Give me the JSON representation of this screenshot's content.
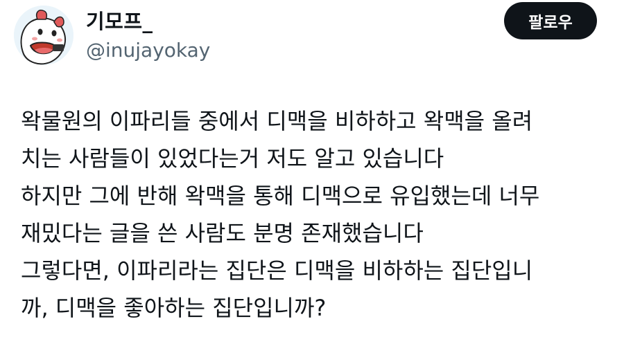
{
  "user": {
    "display_name": "기모프_",
    "handle": "@inujayokay",
    "avatar_icon": "cartoon-dog-avatar"
  },
  "follow_button": {
    "label": "팔로우"
  },
  "tweet": {
    "lines": [
      "왁물원의 이파리들 중에서 디맥을 비하하고 왁맥을 올려",
      "치는 사람들이 있었다는거 저도 알고 있습니다",
      "하지만 그에 반해 왁맥을 통해 디맥으로 유입했는데 너무",
      "재밌다는 글을 쓴 사람도 분명 존재했습니다",
      "그렇다면, 이파리라는 집단은 디맥을 비하하는 집단입니",
      "까, 디맥을 좋아하는 집단입니까?"
    ]
  },
  "colors": {
    "text_primary": "#0f1419",
    "text_secondary": "#536471",
    "button_bg": "#0f1419",
    "button_text": "#ffffff"
  }
}
